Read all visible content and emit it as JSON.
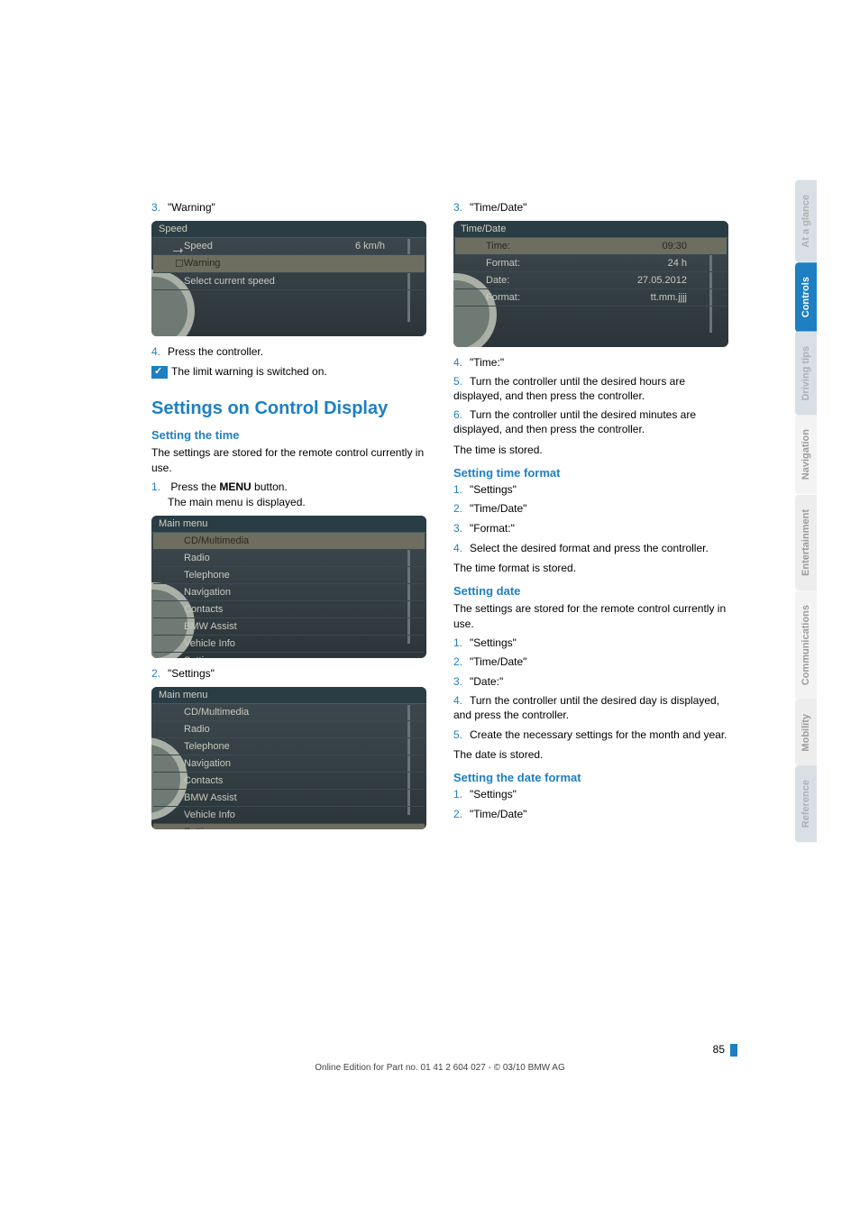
{
  "left": {
    "step3_num": "3.",
    "step3_text": "\"Warning\"",
    "idrive1": {
      "title": "Speed",
      "r1_label": "Speed",
      "r1_val": "6 km/h",
      "r2_label": "Warning",
      "r3_label": "Select current speed"
    },
    "step4_num": "4.",
    "step4_text": "Press the controller.",
    "limit": "The limit warning is switched on.",
    "h2": "Settings on Control Display",
    "h3": "Setting the time",
    "para1": "The settings are stored for the remote control currently in use.",
    "s1_num": "1.",
    "s1_l1": "Press the ",
    "s1_bold": "MENU",
    "s1_l1b": " button.",
    "s1_l2": "The main menu is displayed.",
    "menu": {
      "title": "Main menu",
      "items": [
        "CD/Multimedia",
        "Radio",
        "Telephone",
        "Navigation",
        "Contacts",
        "BMW Assist",
        "Vehicle Info",
        "Settings"
      ]
    },
    "s2_num": "2.",
    "s2_text": "\"Settings\""
  },
  "right": {
    "step3_num": "3.",
    "step3_text": "\"Time/Date\"",
    "idrive": {
      "title": "Time/Date",
      "r1_label": "Time:",
      "r1_val": "09:30",
      "r2_label": "Format:",
      "r2_val": "24 h",
      "r3_label": "Date:",
      "r3_val": "27.05.2012",
      "r4_label": "Format:",
      "r4_val": "tt.mm.jjjj"
    },
    "s4_num": "4.",
    "s4_text": "\"Time:\"",
    "s5_num": "5.",
    "s5_text": "Turn the controller until the desired hours are displayed, and then press the controller.",
    "s6_num": "6.",
    "s6_text": "Turn the controller until the desired minutes are displayed, and then press the controller.",
    "stored": "The time is stored.",
    "h3a": "Setting time format",
    "a1_num": "1.",
    "a1_text": "\"Settings\"",
    "a2_num": "2.",
    "a2_text": "\"Time/Date\"",
    "a3_num": "3.",
    "a3_text": "\"Format:\"",
    "a4_num": "4.",
    "a4_text": "Select the desired format and press the controller.",
    "a_stored": "The time format is stored.",
    "h3b": "Setting date",
    "b_para": "The settings are stored for the remote control currently in use.",
    "b1_num": "1.",
    "b1_text": "\"Settings\"",
    "b2_num": "2.",
    "b2_text": "\"Time/Date\"",
    "b3_num": "3.",
    "b3_text": "\"Date:\"",
    "b4_num": "4.",
    "b4_text": "Turn the controller until the desired day is displayed, and press the controller.",
    "b5_num": "5.",
    "b5_text": "Create the necessary settings for the month and year.",
    "b_stored": "The date is stored.",
    "h3c": "Setting the date format",
    "c1_num": "1.",
    "c1_text": "\"Settings\"",
    "c2_num": "2.",
    "c2_text": "\"Time/Date\""
  },
  "tabs": {
    "t1": "At a glance",
    "t2": "Controls",
    "t3": "Driving tips",
    "t4": "Navigation",
    "t5": "Entertainment",
    "t6": "Communications",
    "t7": "Mobility",
    "t8": "Reference"
  },
  "footer": {
    "page": "85",
    "line": "Online Edition for Part no. 01 41 2 604 027 - © 03/10 BMW AG"
  }
}
